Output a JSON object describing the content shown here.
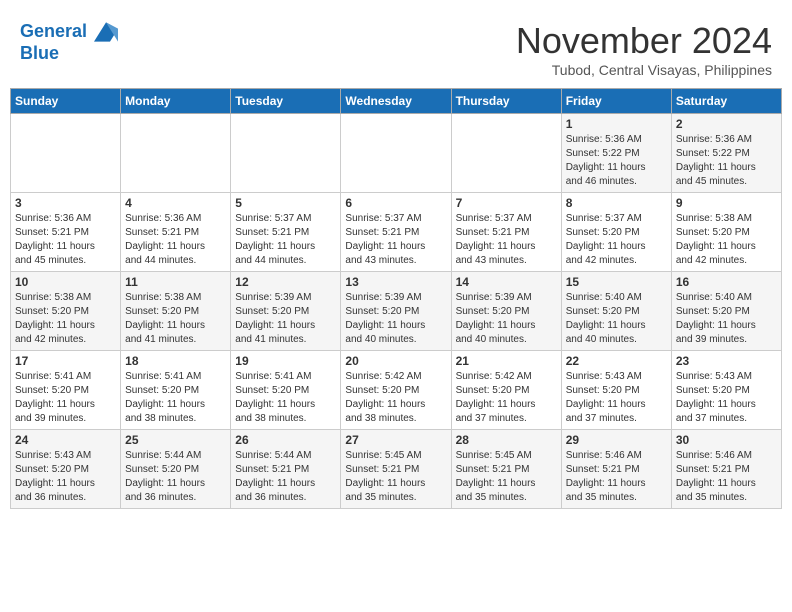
{
  "header": {
    "logo_line1": "General",
    "logo_line2": "Blue",
    "month": "November 2024",
    "location": "Tubod, Central Visayas, Philippines"
  },
  "weekdays": [
    "Sunday",
    "Monday",
    "Tuesday",
    "Wednesday",
    "Thursday",
    "Friday",
    "Saturday"
  ],
  "weeks": [
    [
      {
        "day": "",
        "info": ""
      },
      {
        "day": "",
        "info": ""
      },
      {
        "day": "",
        "info": ""
      },
      {
        "day": "",
        "info": ""
      },
      {
        "day": "",
        "info": ""
      },
      {
        "day": "1",
        "info": "Sunrise: 5:36 AM\nSunset: 5:22 PM\nDaylight: 11 hours\nand 46 minutes."
      },
      {
        "day": "2",
        "info": "Sunrise: 5:36 AM\nSunset: 5:22 PM\nDaylight: 11 hours\nand 45 minutes."
      }
    ],
    [
      {
        "day": "3",
        "info": "Sunrise: 5:36 AM\nSunset: 5:21 PM\nDaylight: 11 hours\nand 45 minutes."
      },
      {
        "day": "4",
        "info": "Sunrise: 5:36 AM\nSunset: 5:21 PM\nDaylight: 11 hours\nand 44 minutes."
      },
      {
        "day": "5",
        "info": "Sunrise: 5:37 AM\nSunset: 5:21 PM\nDaylight: 11 hours\nand 44 minutes."
      },
      {
        "day": "6",
        "info": "Sunrise: 5:37 AM\nSunset: 5:21 PM\nDaylight: 11 hours\nand 43 minutes."
      },
      {
        "day": "7",
        "info": "Sunrise: 5:37 AM\nSunset: 5:21 PM\nDaylight: 11 hours\nand 43 minutes."
      },
      {
        "day": "8",
        "info": "Sunrise: 5:37 AM\nSunset: 5:20 PM\nDaylight: 11 hours\nand 42 minutes."
      },
      {
        "day": "9",
        "info": "Sunrise: 5:38 AM\nSunset: 5:20 PM\nDaylight: 11 hours\nand 42 minutes."
      }
    ],
    [
      {
        "day": "10",
        "info": "Sunrise: 5:38 AM\nSunset: 5:20 PM\nDaylight: 11 hours\nand 42 minutes."
      },
      {
        "day": "11",
        "info": "Sunrise: 5:38 AM\nSunset: 5:20 PM\nDaylight: 11 hours\nand 41 minutes."
      },
      {
        "day": "12",
        "info": "Sunrise: 5:39 AM\nSunset: 5:20 PM\nDaylight: 11 hours\nand 41 minutes."
      },
      {
        "day": "13",
        "info": "Sunrise: 5:39 AM\nSunset: 5:20 PM\nDaylight: 11 hours\nand 40 minutes."
      },
      {
        "day": "14",
        "info": "Sunrise: 5:39 AM\nSunset: 5:20 PM\nDaylight: 11 hours\nand 40 minutes."
      },
      {
        "day": "15",
        "info": "Sunrise: 5:40 AM\nSunset: 5:20 PM\nDaylight: 11 hours\nand 40 minutes."
      },
      {
        "day": "16",
        "info": "Sunrise: 5:40 AM\nSunset: 5:20 PM\nDaylight: 11 hours\nand 39 minutes."
      }
    ],
    [
      {
        "day": "17",
        "info": "Sunrise: 5:41 AM\nSunset: 5:20 PM\nDaylight: 11 hours\nand 39 minutes."
      },
      {
        "day": "18",
        "info": "Sunrise: 5:41 AM\nSunset: 5:20 PM\nDaylight: 11 hours\nand 38 minutes."
      },
      {
        "day": "19",
        "info": "Sunrise: 5:41 AM\nSunset: 5:20 PM\nDaylight: 11 hours\nand 38 minutes."
      },
      {
        "day": "20",
        "info": "Sunrise: 5:42 AM\nSunset: 5:20 PM\nDaylight: 11 hours\nand 38 minutes."
      },
      {
        "day": "21",
        "info": "Sunrise: 5:42 AM\nSunset: 5:20 PM\nDaylight: 11 hours\nand 37 minutes."
      },
      {
        "day": "22",
        "info": "Sunrise: 5:43 AM\nSunset: 5:20 PM\nDaylight: 11 hours\nand 37 minutes."
      },
      {
        "day": "23",
        "info": "Sunrise: 5:43 AM\nSunset: 5:20 PM\nDaylight: 11 hours\nand 37 minutes."
      }
    ],
    [
      {
        "day": "24",
        "info": "Sunrise: 5:43 AM\nSunset: 5:20 PM\nDaylight: 11 hours\nand 36 minutes."
      },
      {
        "day": "25",
        "info": "Sunrise: 5:44 AM\nSunset: 5:20 PM\nDaylight: 11 hours\nand 36 minutes."
      },
      {
        "day": "26",
        "info": "Sunrise: 5:44 AM\nSunset: 5:21 PM\nDaylight: 11 hours\nand 36 minutes."
      },
      {
        "day": "27",
        "info": "Sunrise: 5:45 AM\nSunset: 5:21 PM\nDaylight: 11 hours\nand 35 minutes."
      },
      {
        "day": "28",
        "info": "Sunrise: 5:45 AM\nSunset: 5:21 PM\nDaylight: 11 hours\nand 35 minutes."
      },
      {
        "day": "29",
        "info": "Sunrise: 5:46 AM\nSunset: 5:21 PM\nDaylight: 11 hours\nand 35 minutes."
      },
      {
        "day": "30",
        "info": "Sunrise: 5:46 AM\nSunset: 5:21 PM\nDaylight: 11 hours\nand 35 minutes."
      }
    ]
  ]
}
